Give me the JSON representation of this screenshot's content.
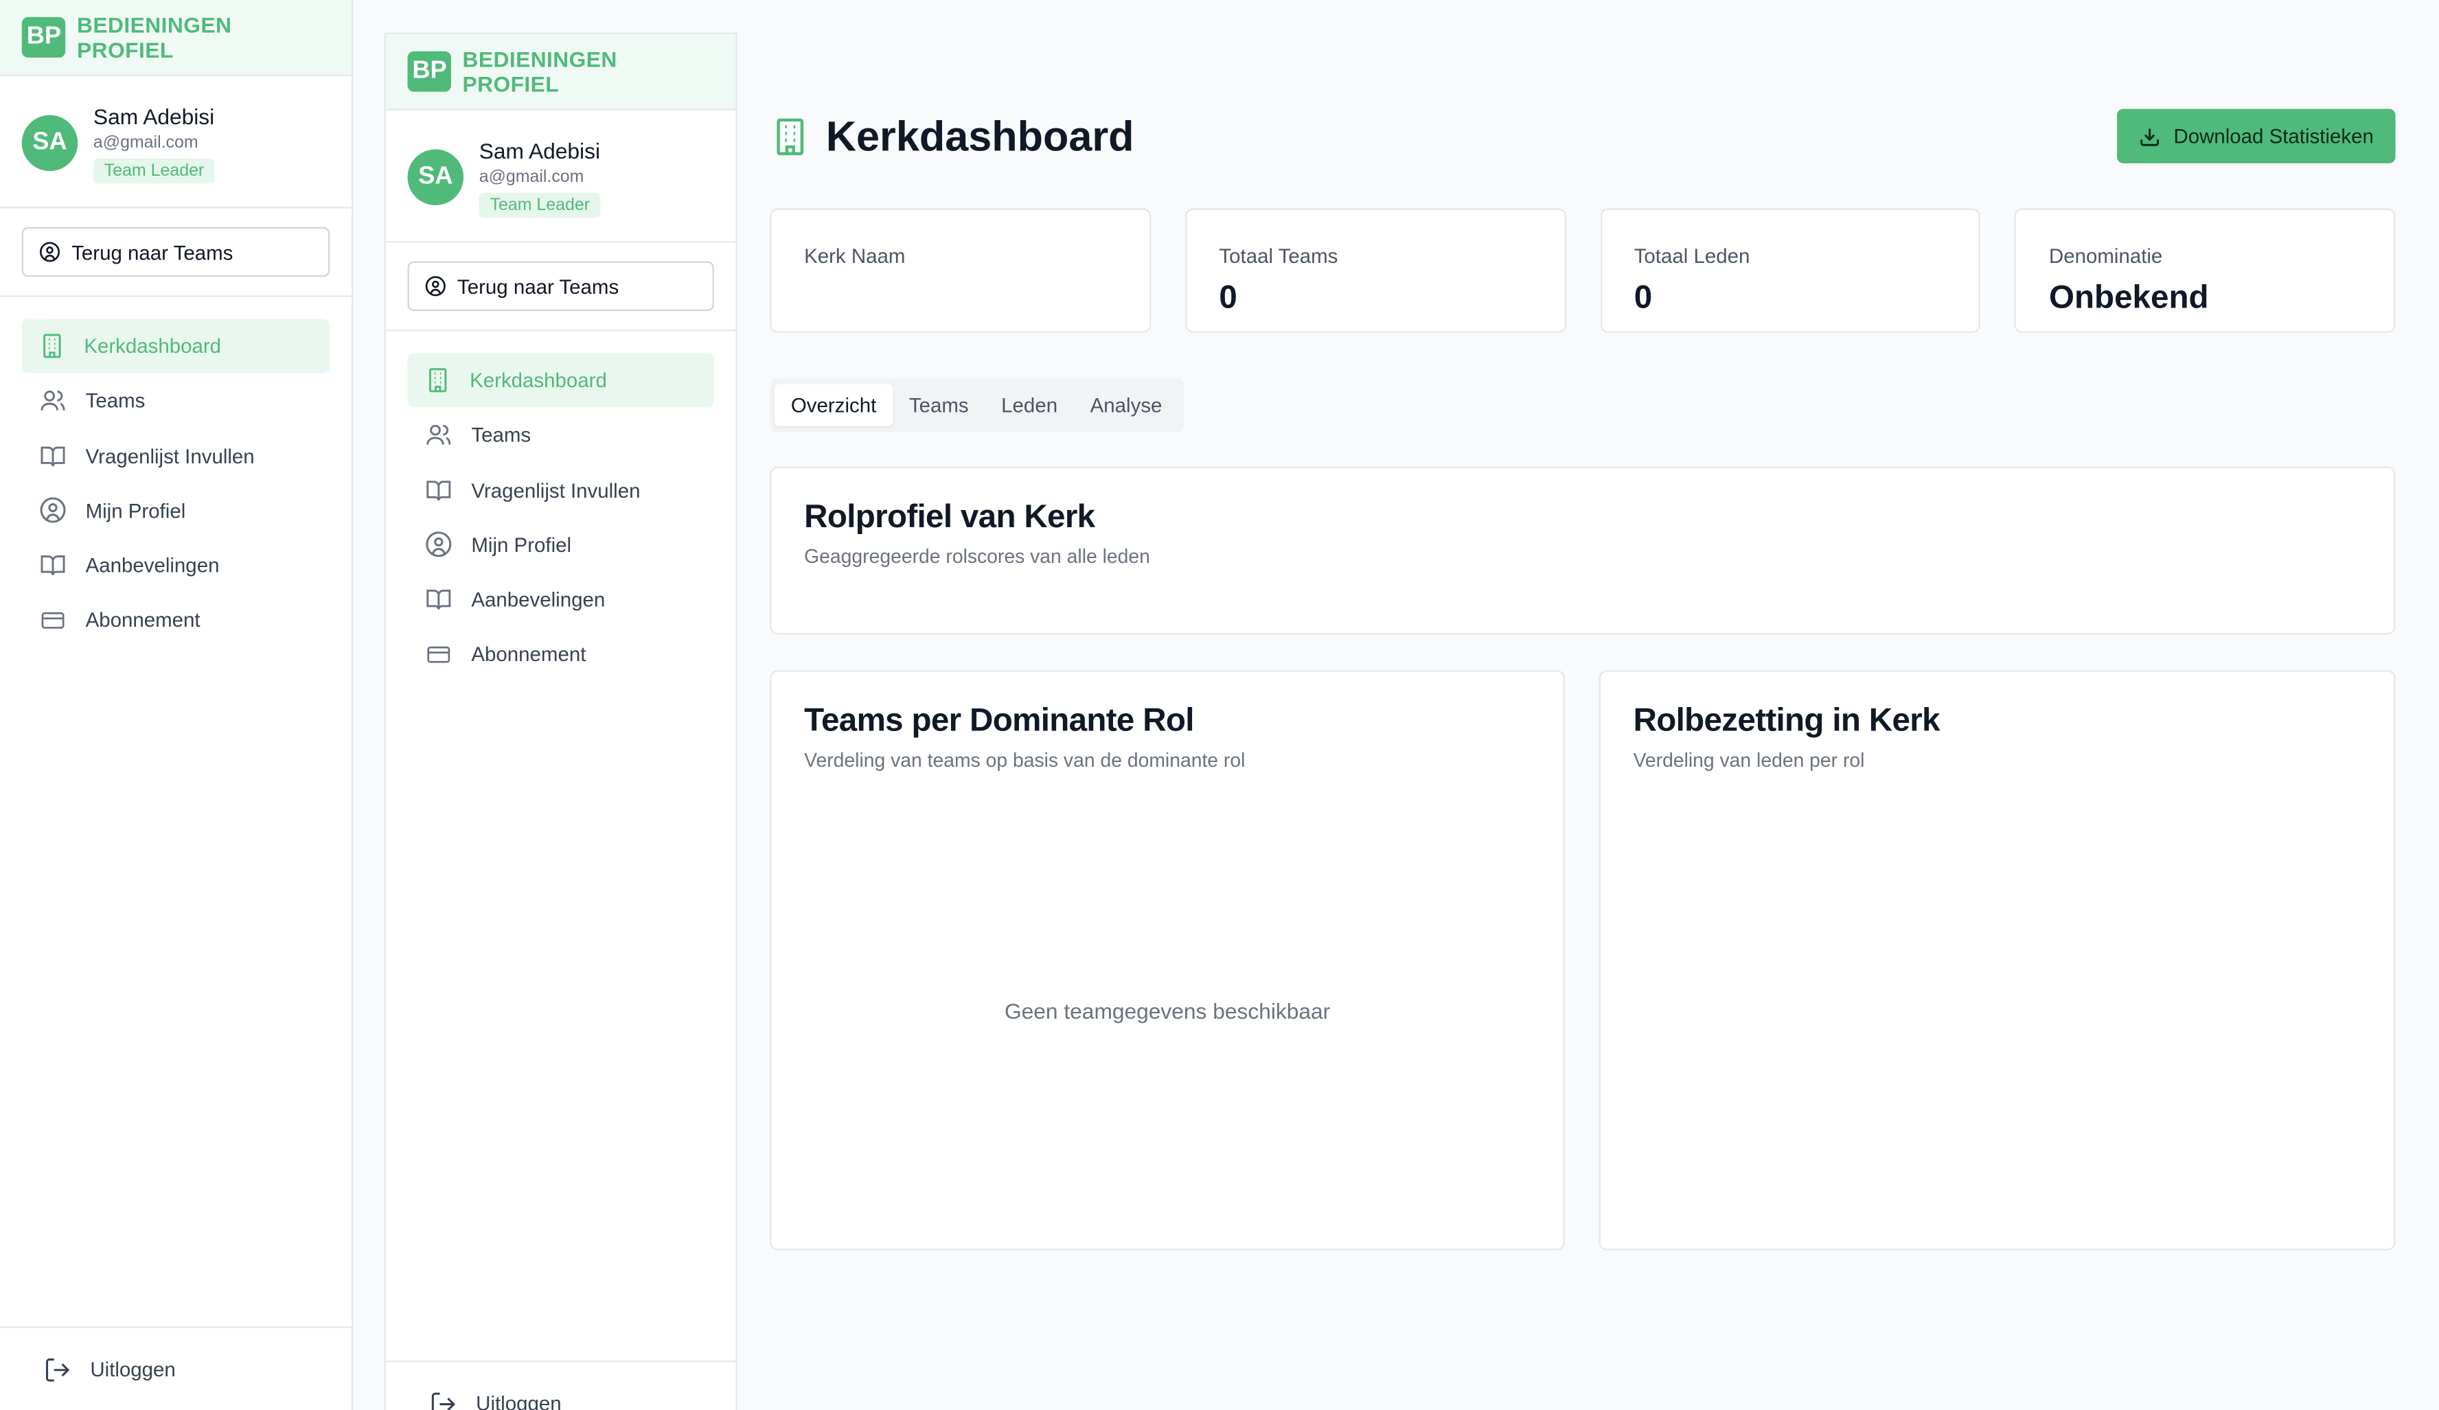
{
  "brand": {
    "logo": "BP",
    "name": "BEDIENINGEN PROFIEL"
  },
  "user": {
    "initials": "SA",
    "name": "Sam Adebisi",
    "email": "a@gmail.com",
    "role": "Team Leader"
  },
  "back_button": "Terug naar Teams",
  "nav": [
    {
      "label": "Kerkdashboard",
      "icon": "building-icon",
      "active": true
    },
    {
      "label": "Teams",
      "icon": "users-icon",
      "active": false
    },
    {
      "label": "Vragenlijst Invullen",
      "icon": "book-icon",
      "active": false
    },
    {
      "label": "Mijn Profiel",
      "icon": "user-circle-icon",
      "active": false
    },
    {
      "label": "Aanbevelingen",
      "icon": "book-icon",
      "active": false
    },
    {
      "label": "Abonnement",
      "icon": "credit-card-icon",
      "active": false
    }
  ],
  "logout": "Uitloggen",
  "main": {
    "title": "Kerkdashboard",
    "download_button": "Download Statistieken",
    "stats": [
      {
        "label": "Kerk Naam",
        "value": ""
      },
      {
        "label": "Totaal Teams",
        "value": "0"
      },
      {
        "label": "Totaal Leden",
        "value": "0"
      },
      {
        "label": "Denominatie",
        "value": "Onbekend"
      }
    ],
    "tabs": [
      "Overzicht",
      "Teams",
      "Leden",
      "Analyse"
    ],
    "active_tab": "Overzicht",
    "role_profile": {
      "title": "Rolprofiel van Kerk",
      "subtitle": "Geaggregeerde rolscores van alle leden"
    },
    "teams_by_role": {
      "title": "Teams per Dominante Rol",
      "subtitle": "Verdeling van teams op basis van de dominante rol",
      "empty": "Geen teamgegevens beschikbaar"
    },
    "role_coverage": {
      "title": "Rolbezetting in Kerk",
      "subtitle": "Verdeling van leden per rol"
    }
  },
  "colors": {
    "accent": "#4fba7a",
    "accent_light": "#eaf7ef"
  }
}
